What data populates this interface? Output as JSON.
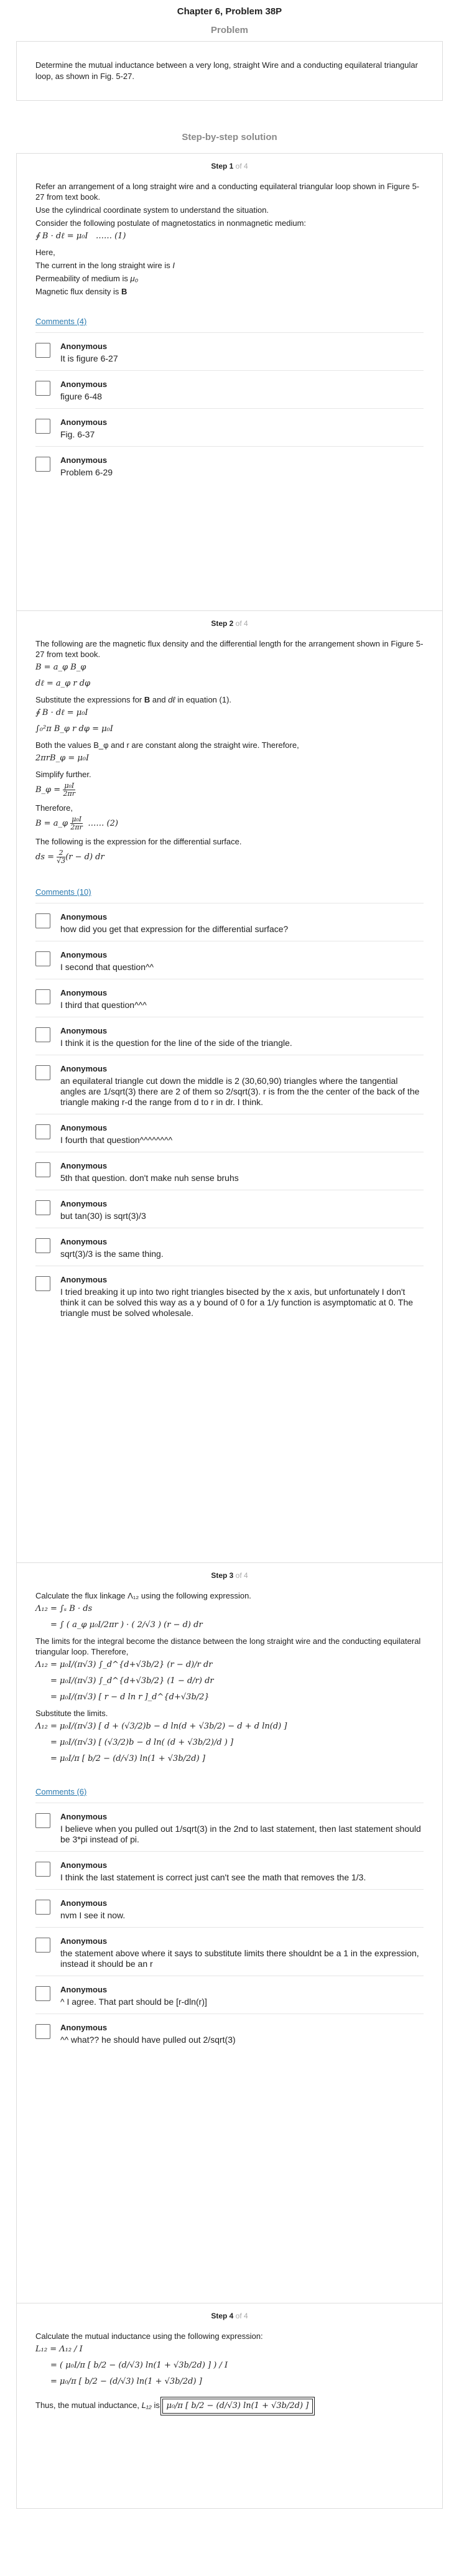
{
  "header": {
    "title": "Chapter 6, Problem 38P"
  },
  "problem": {
    "heading": "Problem",
    "text": "Determine the mutual inductance between a very long, straight Wire and a conducting equilateral triangular loop, as shown in Fig. 5-27."
  },
  "solution": {
    "heading": "Step-by-step solution"
  },
  "steps": [
    {
      "label": "Step 1",
      "of": "of 4",
      "p1": "Refer an arrangement of a long straight wire and a conducting equilateral triangular loop shown in Figure 5-27 from text book.",
      "p2": "Use the cylindrical coordinate system to understand the situation.",
      "p3": "Consider the following postulate of magnetostatics in nonmagnetic medium:",
      "eq1": "∮ B · dℓ = μ₀I   …… (1)",
      "here": "Here,",
      "cur": "The current in the long straight wire is",
      "cur_sym": "I",
      "perm": "Permeability of medium is",
      "perm_sym": "μ₀",
      "flux": "Magnetic flux density is",
      "flux_sym": "B",
      "comments_link": "Comments (4)",
      "comments": [
        {
          "author": "Anonymous",
          "text": "It is figure 6-27"
        },
        {
          "author": "Anonymous",
          "text": "figure 6-48"
        },
        {
          "author": "Anonymous",
          "text": "Fig. 6-37"
        },
        {
          "author": "Anonymous",
          "text": "Problem 6-29"
        }
      ]
    },
    {
      "label": "Step 2",
      "of": "of 4",
      "p1": "The following are the magnetic flux density and the differential length for the arrangement shown in Figure 5-27 from text book.",
      "eq_b": "B = a_φ B_φ",
      "eq_dl": "dℓ = a_φ r dφ",
      "p2": "Substitute the expressions for",
      "p2_b": "B",
      "p2_and": "and",
      "p2_dl": "dℓ",
      "p2_end": "in equation (1).",
      "eq3": "∮ B · dℓ = μ₀I",
      "eq4": "∫₀²π B_φ r dφ = μ₀I",
      "p3": "Both the values B_φ and r are constant along the straight wire. Therefore,",
      "eq5": "2πrB_φ = μ₀I",
      "p4": "Simplify further.",
      "eq6_lhs": "B_φ =",
      "eq6_num": "μ₀I",
      "eq6_den": "2πr",
      "p5": "Therefore,",
      "eq7_lhs": "B = a_φ",
      "eq7_num": "μ₀I",
      "eq7_den": "2πr",
      "eq7_tag": "…… (2)",
      "p6": "The following is the expression for the differential surface.",
      "eq8_lhs": "ds =",
      "eq8_num": "2",
      "eq8_den": "√3",
      "eq8_rhs": "(r − d) dr",
      "comments_link": "Comments (10)",
      "comments": [
        {
          "author": "Anonymous",
          "text": "how did you get that expression for the differential surface?"
        },
        {
          "author": "Anonymous",
          "text": "I second that question^^"
        },
        {
          "author": "Anonymous",
          "text": "I third that question^^^"
        },
        {
          "author": "Anonymous",
          "text": "I think it is the question for the line of the side of the triangle."
        },
        {
          "author": "Anonymous",
          "text": "an equilateral triangle cut down the middle is 2 (30,60,90) triangles where the tangential angles are 1/sqrt(3) there are 2 of them so 2/sqrt(3). r is from the the center of the back of the triangle making r-d the range from d to r in dr. I think."
        },
        {
          "author": "Anonymous",
          "text": "I fourth that question^^^^^^^^"
        },
        {
          "author": "Anonymous",
          "text": "5th that question. don't make nuh sense bruhs"
        },
        {
          "author": "Anonymous",
          "text": "but tan(30) is sqrt(3)/3"
        },
        {
          "author": "Anonymous",
          "text": "sqrt(3)/3 is the same thing."
        },
        {
          "author": "Anonymous",
          "text": "I tried breaking it up into two right triangles bisected by the x axis, but unfortunately I don't think it can be solved this way as a y bound of 0 for a 1/y function is asymptomatic at 0. The triangle must be solved wholesale."
        }
      ]
    },
    {
      "label": "Step 3",
      "of": "of 4",
      "p1": "Calculate the flux linkage Λ₁₂ using the following expression.",
      "eq1": "Λ₁₂ = ∫ₛ B · ds",
      "eq2": "= ∫ ( a_φ μ₀I/2πr ) · ( 2/√3 ) (r − d) dr",
      "p2": "The limits for the integral become the distance between the long straight wire and the conducting equilateral triangular loop. Therefore,",
      "eq3": "Λ₁₂ = μ₀I/(π√3) ∫_d^{d+√3b/2} (r − d)/r dr",
      "eq4": "= μ₀I/(π√3) ∫_d^{d+√3b/2} (1 − d/r) dr",
      "eq5": "= μ₀I/(π√3) [ r − d ln r ]_d^{d+√3b/2}",
      "p3": "Substitute the limits.",
      "eq6": "Λ₁₂ = μ₀I/(π√3) [ d + (√3/2)b − d ln(d + √3b/2) − d + d ln(d) ]",
      "eq7": "= μ₀I/(π√3) [ (√3/2)b − d ln( (d + √3b/2)/d ) ]",
      "eq8": "= μ₀I/π [ b/2 − (d/√3) ln(1 + √3b/2d) ]",
      "comments_link": "Comments (6)",
      "comments": [
        {
          "author": "Anonymous",
          "text": "I believe when you pulled out 1/sqrt(3) in the 2nd to last statement, then last statement should be 3*pi instead of pi."
        },
        {
          "author": "Anonymous",
          "text": "I think the last statement is correct just can't see the math that removes the 1/3."
        },
        {
          "author": "Anonymous",
          "text": "nvm I see it now."
        },
        {
          "author": "Anonymous",
          "text": "the statement above where it says to substitute limits there shouldnt be a 1 in the expression, instead it should be an r"
        },
        {
          "author": "Anonymous",
          "text": "^ I agree. That part should be [r-dln(r)]"
        },
        {
          "author": "Anonymous",
          "text": "^^ what?? he should have pulled out 2/sqrt(3)"
        }
      ]
    },
    {
      "label": "Step 4",
      "of": "of 4",
      "p1": "Calculate the mutual inductance using the following expression:",
      "eq1": "L₁₂ = Λ₁₂ / I",
      "eq2": "= ( μ₀I/π [ b/2 − (d/√3) ln(1 + √3b/2d) ] ) / I",
      "eq3": "= μ₀/π [ b/2 − (d/√3) ln(1 + √3b/2d) ]",
      "p2": "Thus, the mutual inductance,",
      "ans_sym": "L₁₂",
      "ans_is": "is",
      "ans": "μ₀/π [ b/2 − (d/√3) ln(1 + √3b/2d) ]"
    }
  ]
}
